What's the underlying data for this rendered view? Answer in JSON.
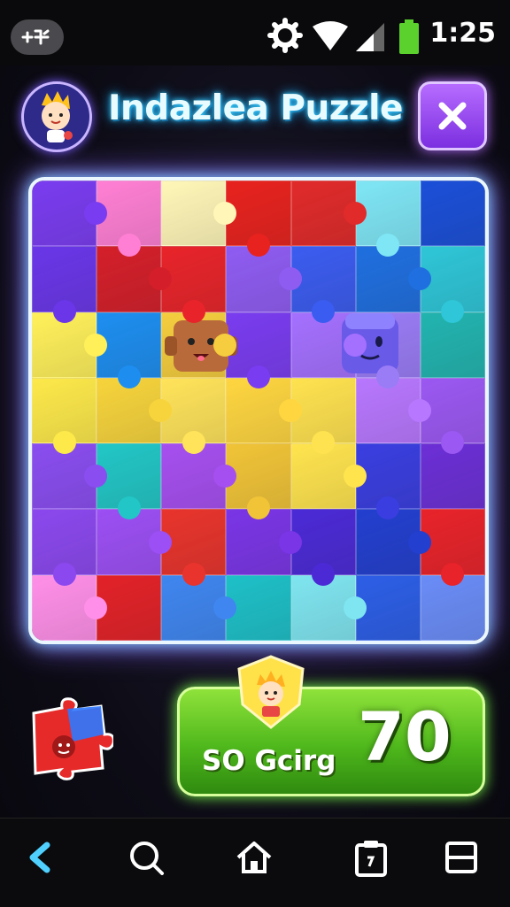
{
  "status_bar": {
    "time": "1:25",
    "icons": [
      "app-shortcut-icon",
      "settings-gear-icon",
      "wifi-icon",
      "signal-icon",
      "battery-icon"
    ]
  },
  "header": {
    "title": "Indazlea Puzzle",
    "avatar_icon": "character-avatar-icon",
    "close_icon": "close-x-icon"
  },
  "board": {
    "rows": [
      [
        "#7a3cf0",
        "#ff7fd4",
        "#fff6b8",
        "#e8221e",
        "#e12a2a",
        "#7fe6f5",
        "#1b4fd8"
      ],
      [
        "#6a36e8",
        "#d41f2a",
        "#e8242a",
        "#8f5cf2",
        "#3b5cf0",
        "#1f6fe0",
        "#2ec6d8"
      ],
      [
        "#fff05a",
        "#1d8ef0",
        "#f5cd3e",
        "#7a3cf0",
        "#a470ff",
        "#9a7cf6",
        "#22b4b0"
      ],
      [
        "#fde94a",
        "#f7d43c",
        "#ffe35a",
        "#ffd640",
        "#ffe24f",
        "#b877ff",
        "#9b58f2"
      ],
      [
        "#8a4df0",
        "#22c6c6",
        "#a64ff0",
        "#f1c437",
        "#ffe44e",
        "#3a3ee0",
        "#6c2fd6"
      ],
      [
        "#8b48ee",
        "#9c4ff4",
        "#e8342c",
        "#7a35e6",
        "#4b2ad6",
        "#233fcf",
        "#e8232a"
      ],
      [
        "#ff8fe8",
        "#e22228",
        "#3f86f0",
        "#1ec0c8",
        "#7fe5f0",
        "#2c5ee6",
        "#6a8cf7"
      ]
    ]
  },
  "characters": [
    "brown-block-character-icon",
    "purple-block-character-icon"
  ],
  "score": {
    "label": "SO Gcirg",
    "value": "70",
    "badge_icon": "character-badge-icon"
  },
  "loose_piece_icon": "puzzle-piece-icon",
  "nav": [
    "back-icon",
    "search-icon",
    "home-icon",
    "clipboard-icon",
    "recents-icon"
  ]
}
